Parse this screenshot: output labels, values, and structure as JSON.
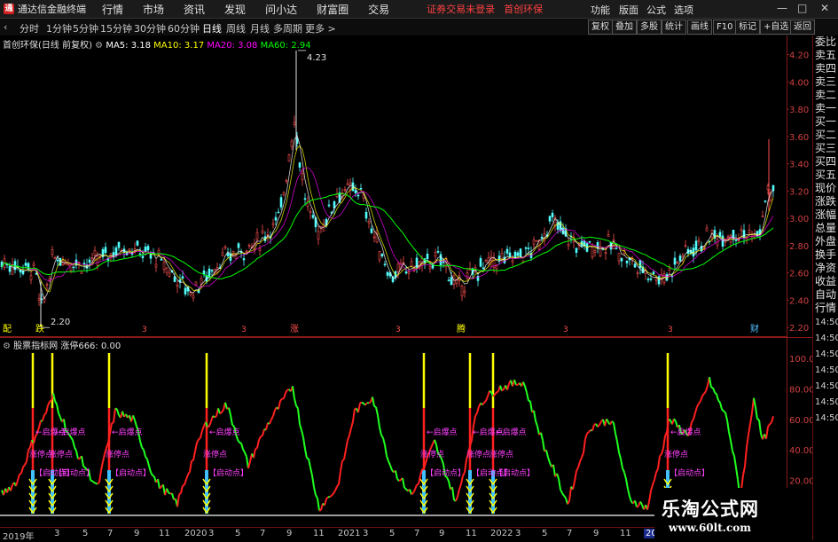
{
  "menubar": {
    "app_title": "通达信金融终端",
    "menus": [
      "行情",
      "市场",
      "资讯",
      "发现",
      "问小达",
      "财富圈",
      "交易"
    ],
    "notice": "证券交易未登录",
    "stock_name": "首创环保",
    "right_menus": [
      "功能",
      "版面",
      "公式",
      "选项"
    ],
    "window_buttons": [
      "—",
      "□",
      "✕"
    ]
  },
  "periods": [
    "分时",
    "1分钟",
    "5分钟",
    "15分钟",
    "30分钟",
    "60分钟",
    "日线",
    "周线",
    "月线",
    "多周期",
    "更多 >"
  ],
  "active_period": "日线",
  "tools": [
    "复权",
    "叠加",
    "多股",
    "统计",
    "画线",
    "F10",
    "标记",
    "+自选",
    "返回"
  ],
  "main_info": {
    "title": "首创环保(日线 前复权)",
    "ma5": "MA5: 3.18",
    "ma10": "MA10: 3.17",
    "ma20": "MA20: 3.08",
    "ma60": "MA60: 2.94"
  },
  "sub_info": {
    "title": "股票指标网 涨停666: 0.00"
  },
  "right_panel": [
    "委比",
    "卖五",
    "卖四",
    "卖三",
    "卖二",
    "卖一",
    "买一",
    "买二",
    "买三",
    "买四",
    "买五",
    "现价",
    "涨跌",
    "涨幅",
    "总量",
    "外盘",
    "换手",
    "净资",
    "收益",
    "自动",
    "行情",
    "14:50",
    "14:50",
    "14:50",
    "14:50",
    "14:50",
    "14:50",
    "14:50"
  ],
  "price_axis": [
    "4.20",
    "4.00",
    "3.80",
    "3.60",
    "3.40",
    "3.20",
    "3.00",
    "2.80",
    "2.60",
    "2.40",
    "2.20"
  ],
  "indicator_axis": [
    "100.00",
    "80.00",
    "60.00",
    "40.00",
    "20.00"
  ],
  "annotations": {
    "high": "4.23",
    "low": "2.20",
    "event_labels": [
      "配",
      "跌",
      "涨",
      "腾",
      "财"
    ],
    "event_digit": "3",
    "indicator_labels": [
      "启爆点",
      "涨停点",
      "启动点"
    ]
  },
  "time_axis": [
    "2019年",
    "3",
    "5",
    "7",
    "9",
    "11",
    "2020",
    "3",
    "5",
    "7",
    "9",
    "11",
    "2021",
    "3",
    "5",
    "7",
    "9",
    "11",
    "2022",
    "3",
    "5",
    "7",
    "9",
    "11",
    "2023/1"
  ],
  "watermark": {
    "title": "乐淘公式网",
    "url": "www.60lt.com"
  },
  "colors": {
    "candle_up": "#ff5050",
    "candle_down": "#54ffff",
    "ma5": "#ffffff",
    "ma10": "#ffff00",
    "ma20": "#ff00ff",
    "ma60": "#00ff00",
    "indicator_up": "#ff2020",
    "indicator_down": "#20ff20",
    "signal_yellow": "#ffff00",
    "label_magenta": "#ff40ff"
  }
}
